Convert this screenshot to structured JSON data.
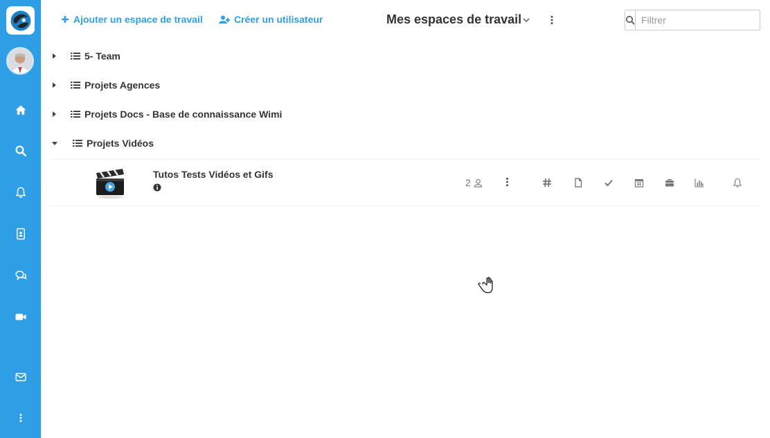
{
  "sidebar": {
    "brand_color": "#2e9fe6",
    "items": [
      {
        "icon": "home-icon"
      },
      {
        "icon": "search-icon"
      },
      {
        "icon": "bell-icon"
      },
      {
        "icon": "contacts-icon"
      },
      {
        "icon": "chat-icon"
      },
      {
        "icon": "video-icon"
      },
      {
        "icon": "mail-icon"
      },
      {
        "icon": "more-vertical-icon"
      }
    ]
  },
  "header": {
    "add_workspace_label": "Ajouter un espace de travail",
    "create_user_label": "Créer un utilisateur",
    "title": "Mes espaces de travail",
    "filter_placeholder": "Filtrer"
  },
  "tree": [
    {
      "label": "5- Team",
      "expanded": false
    },
    {
      "label": "Projets Agences",
      "expanded": false
    },
    {
      "label": "Projets Docs - Base de connaissance Wimi",
      "expanded": false
    },
    {
      "label": "Projets Vidéos",
      "expanded": true
    }
  ],
  "workspace": {
    "title": "Tutos Tests Vidéos et Gifs",
    "member_count": "2",
    "tools": [
      "hash-icon",
      "file-icon",
      "check-icon",
      "calendar-icon",
      "briefcase-icon",
      "bar-chart-icon",
      "bell-icon"
    ]
  }
}
